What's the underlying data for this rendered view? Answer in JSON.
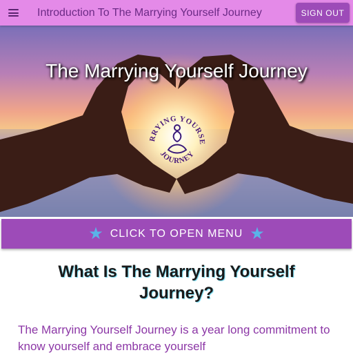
{
  "app_bar": {
    "menu_icon": "hamburger-menu-icon",
    "title": "Introduction To The Marrying Yourself Journey",
    "signout_label": "SIGN OUT",
    "background_color": "#e48ae8",
    "button_color": "#9d4bb8"
  },
  "hero": {
    "title": "The Marrying Yourself Journey",
    "logo": {
      "top_text": "MARRYING YOURSELF",
      "bottom_text": "JOURNEY"
    }
  },
  "menu_button": {
    "label": "CLICK TO OPEN MENU",
    "star_icon": "star-icon",
    "star_color": "#5ab4e8"
  },
  "section": {
    "heading": "What Is The Marrying Yourself Journey?",
    "intro": "The Marrying Yourself Journey is a year long commitment to know yourself and embrace yourself"
  }
}
